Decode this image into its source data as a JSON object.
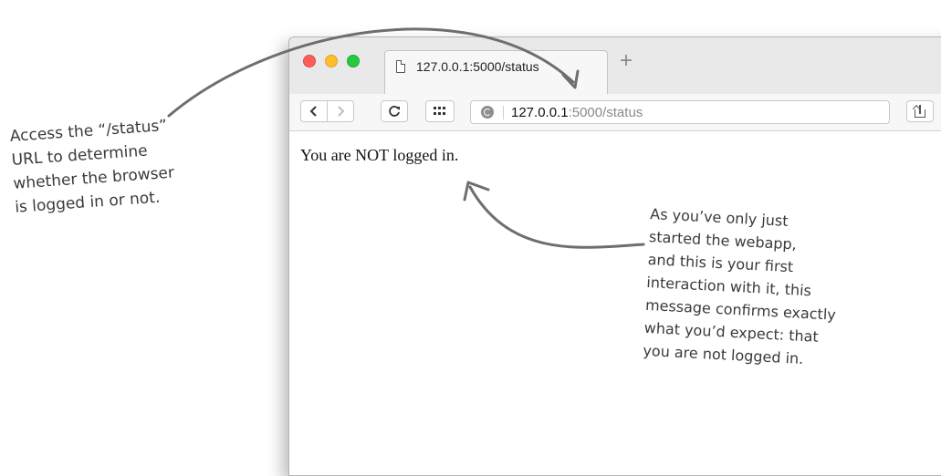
{
  "browser": {
    "tab": {
      "title": "127.0.0.1:5000/status",
      "icon": "document-icon"
    },
    "new_tab_symbol": "+",
    "toolbar": {
      "back_icon": "chevron-left-icon",
      "forward_icon": "chevron-right-icon",
      "reload_icon": "reload-icon",
      "grid_icon": "grid-icon",
      "url_host": "127.0.0.1",
      "url_rest": ":5000/status",
      "heart_icon": "heart-icon",
      "share_icon": "share-icon"
    }
  },
  "page": {
    "message": "You are NOT logged in."
  },
  "annotations": {
    "left_note": [
      "Access the “/status”",
      "URL to determine",
      "whether the browser",
      "is logged in or not."
    ],
    "right_note": [
      "As you’ve only just",
      "started the webapp,",
      "and this is your first",
      "interaction with it, this",
      "message confirms exactly",
      "what you’d expect: that",
      "you are not logged in."
    ]
  },
  "colors": {
    "traffic_red": "#fd5f57",
    "traffic_yellow": "#febc2e",
    "traffic_green": "#28c840",
    "annotation_ink": "#3a3a3a"
  }
}
